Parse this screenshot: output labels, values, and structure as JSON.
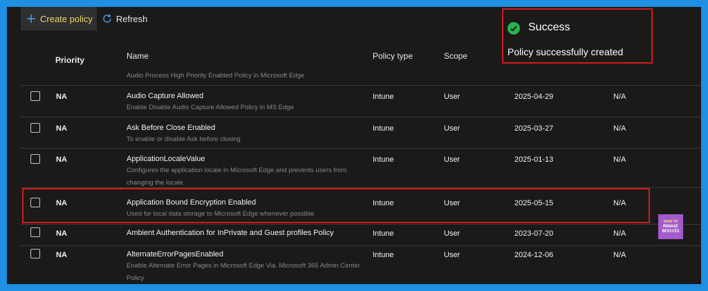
{
  "toolbar": {
    "create_label": "Create policy",
    "refresh_label": "Refresh"
  },
  "table": {
    "headers": {
      "priority": "Priority",
      "sort_icon": "↑",
      "name": "Name",
      "type": "Policy type",
      "scope": "Scope"
    },
    "partial_row_description": "Audio Process High Priority Enabled Policy in Microsoft Edge",
    "rows": [
      {
        "priority": "NA",
        "name": "Audio Capture Allowed",
        "description": "Enable Disable Audio Capture Allowed Policy in MS Edge",
        "type": "Intune",
        "scope": "User",
        "date": "2025-04-29",
        "last": "N/A"
      },
      {
        "priority": "NA",
        "name": "Ask Before Close Enabled",
        "description": "To enable or disable Ask before closing",
        "type": "Intune",
        "scope": "User",
        "date": "2025-03-27",
        "last": "N/A"
      },
      {
        "priority": "NA",
        "name": "ApplicationLocaleValue",
        "description": "Configures the application locale in Microsoft Edge and prevents users from changing the locale.",
        "type": "Intune",
        "scope": "User",
        "date": "2025-01-13",
        "last": "N/A"
      },
      {
        "priority": "NA",
        "name": "Application Bound Encryption Enabled",
        "description": "Used for local data storage to Microsoft Edge whenever possible",
        "type": "Intune",
        "scope": "User",
        "date": "2025-05-15",
        "last": "N/A"
      },
      {
        "priority": "NA",
        "name": "Ambient Authentication for InPrivate and Guest profiles Policy",
        "description": "",
        "type": "Intune",
        "scope": "User",
        "date": "2023-07-20",
        "last": "N/A"
      },
      {
        "priority": "NA",
        "name": "AlternateErrorPagesEnabled",
        "description": "Enable Alternate Error Pages in Microsoft Edge Via. Microsoft 365 Admin Center Policy",
        "type": "Intune",
        "scope": "User",
        "date": "2024-12-06",
        "last": "N/A"
      }
    ]
  },
  "toast": {
    "title": "Success",
    "message": "Policy successfully created"
  },
  "logo": {
    "line1": "HOW TO",
    "line2": "MANAGE",
    "line3": "DEVICES"
  },
  "colors": {
    "accent": "#e9d96b",
    "success": "#2bb24c",
    "highlight": "#d11b1b",
    "border_frame": "#1e8fe1"
  }
}
